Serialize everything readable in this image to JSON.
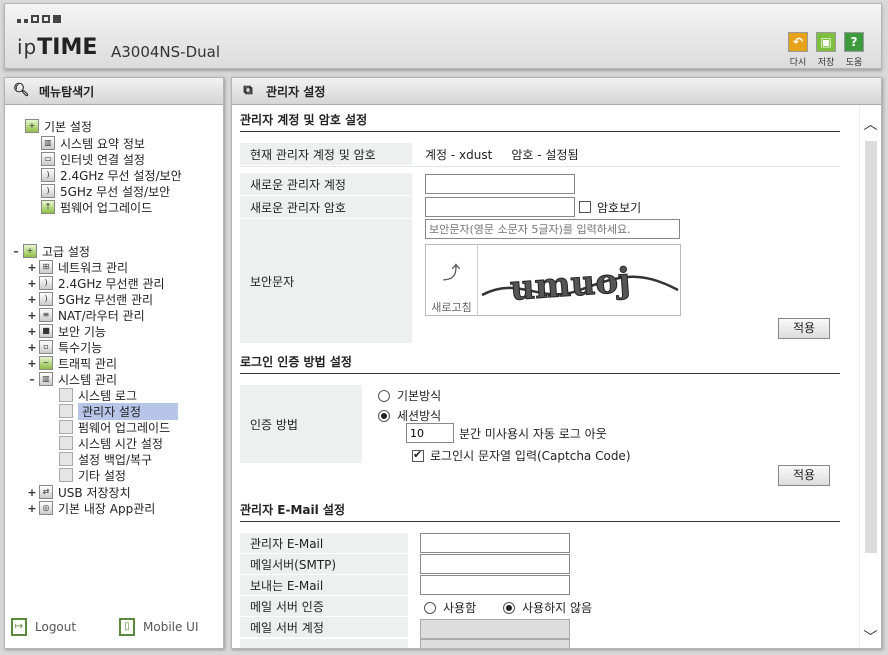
{
  "header": {
    "brand_light": "ip",
    "brand_bold": "TIME",
    "model": "A3004NS-Dual",
    "tools": [
      {
        "label": "다시",
        "icon": "undo-icon",
        "color": "#e6a21a",
        "glyph": "↶"
      },
      {
        "label": "저장",
        "icon": "save-icon",
        "color": "#7fbf3f",
        "glyph": "▣"
      },
      {
        "label": "도움",
        "icon": "help-icon",
        "color": "#3d9a3d",
        "glyph": "?"
      }
    ]
  },
  "left": {
    "title": "메뉴탐색기",
    "basic": {
      "label": "기본 설정",
      "items": [
        "시스템 요약 정보",
        "인터넷 연결 설정",
        "2.4GHz 무선 설정/보안",
        "5GHz 무선 설정/보안",
        "펌웨어 업그레이드"
      ]
    },
    "advanced": {
      "label": "고급 설정",
      "items": [
        "네트워크 관리",
        "2.4GHz 무선랜 관리",
        "5GHz 무선랜 관리",
        "NAT/라우터 관리",
        "보안 기능",
        "특수기능",
        "트래픽 관리",
        "시스템 관리"
      ],
      "system_children": [
        "시스템 로그",
        "관리자 설정",
        "펌웨어 업그레이드",
        "시스템 시간 설정",
        "설정 백업/복구",
        "기타 설정"
      ],
      "after": [
        "USB 저장장치",
        "기본 내장 App관리"
      ]
    },
    "logout": "Logout",
    "mobile": "Mobile UI"
  },
  "right": {
    "title": "관리자 설정",
    "account": {
      "title": "관리자 계정 및 암호 설정",
      "current_label": "현재 관리자 계정 및 암호",
      "current_value": "계정 - xdust     암호 - 설정됨",
      "new_account_label": "새로운 관리자 계정",
      "new_account_value": "",
      "new_password_label": "새로운 관리자 암호",
      "new_password_value": "",
      "show_password": "암호보기",
      "captcha_label": "보안문자",
      "captcha_placeholder": "보안문자(영문 소문자 5글자)를 입력하세요.",
      "captcha_text": "umuoj",
      "refresh": "새로고침",
      "apply": "적용"
    },
    "login": {
      "title": "로그인 인증 방법 설정",
      "method_label": "인증 방법",
      "basic": "기본방식",
      "session": "세션방식",
      "minutes": "10",
      "minutes_suffix": "분간 미사용시 자동 로그 아웃",
      "captcha_login": "로그인시 문자열 입력(Captcha Code)",
      "apply": "적용"
    },
    "email": {
      "title": "관리자 E-Mail 설정",
      "admin_email": "관리자 E-Mail",
      "smtp": "메일서버(SMTP)",
      "sender": "보내는 E-Mail",
      "auth": "메일 서버 인증",
      "auth_use": "사용함",
      "auth_not_use": "사용하지 않음",
      "account": "메일 서버 계정"
    }
  }
}
